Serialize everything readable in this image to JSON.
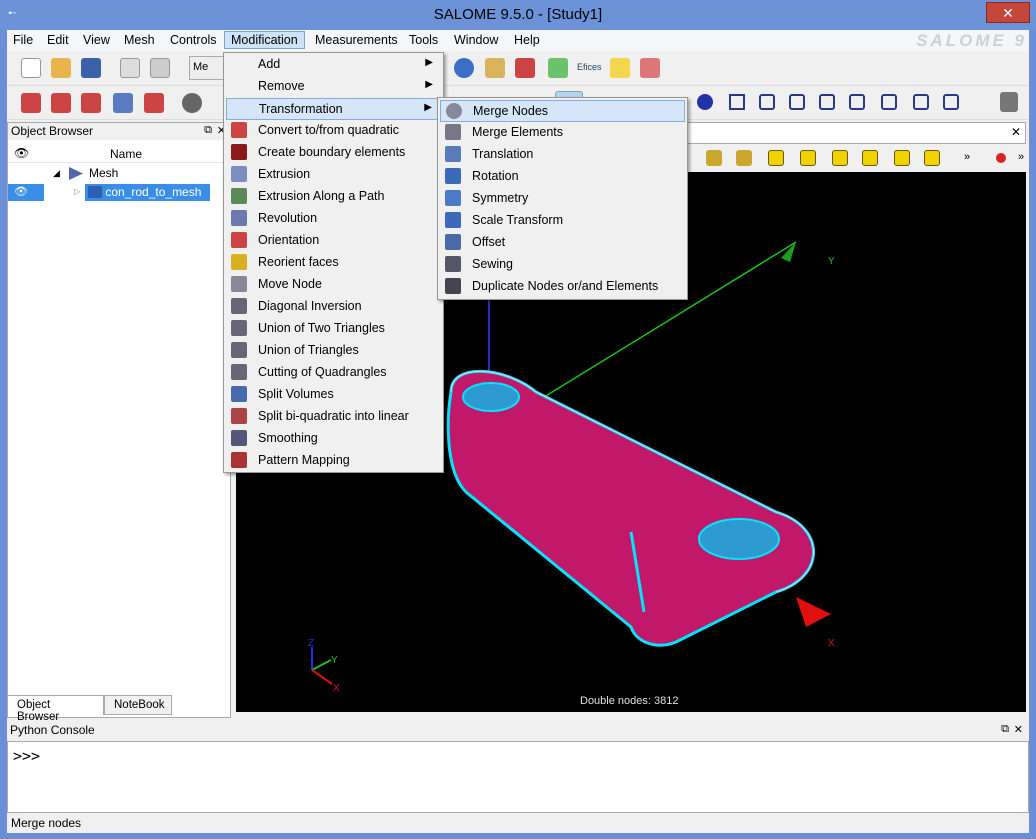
{
  "window": {
    "title": "SALOME  9.5.0 - [Study1]",
    "close_label": "✕"
  },
  "menubar": {
    "items": [
      "File",
      "Edit",
      "View",
      "Mesh",
      "Controls",
      "Modification",
      "Measurements",
      "Tools",
      "Window",
      "Help"
    ],
    "brand": "SALOME 9"
  },
  "object_browser": {
    "title": "Object Browser",
    "column_name": "Name",
    "tree": {
      "root": "Mesh",
      "child": "con_rod_to_mesh"
    },
    "tabs": [
      "Object Browser",
      "NoteBook"
    ]
  },
  "modification_menu": {
    "items": [
      "Add",
      "Remove",
      "Transformation",
      "Convert to/from quadratic",
      "Create boundary elements",
      "Extrusion",
      "Extrusion Along a Path",
      "Revolution",
      "Orientation",
      "Reorient faces",
      "Move Node",
      "Diagonal Inversion",
      "Union of Two Triangles",
      "Union of Triangles",
      "Cutting of Quadrangles",
      "Split Volumes",
      "Split bi-quadratic into linear",
      "Smoothing",
      "Pattern Mapping"
    ]
  },
  "transformation_menu": {
    "items": [
      "Merge Nodes",
      "Merge Elements",
      "Translation",
      "Rotation",
      "Symmetry",
      "Scale Transform",
      "Offset",
      "Sewing",
      "Duplicate Nodes or/and Elements"
    ]
  },
  "viewer": {
    "overlay_text": "Double nodes: 3812",
    "axis_labels": {
      "x": "X",
      "y": "Y",
      "z": "Z"
    }
  },
  "python_console": {
    "title": "Python Console",
    "prompt": ">>>"
  },
  "statusbar": {
    "text": "Merge nodes"
  },
  "toolbar": {
    "mesh_button_label": "Me",
    "mesh_icons_label": "Efices"
  },
  "colors": {
    "titlebar": "#6c92d8",
    "menu_highlight": "#d5e6f8",
    "mesh": "#c2186a",
    "edges": "#00e5ff"
  }
}
